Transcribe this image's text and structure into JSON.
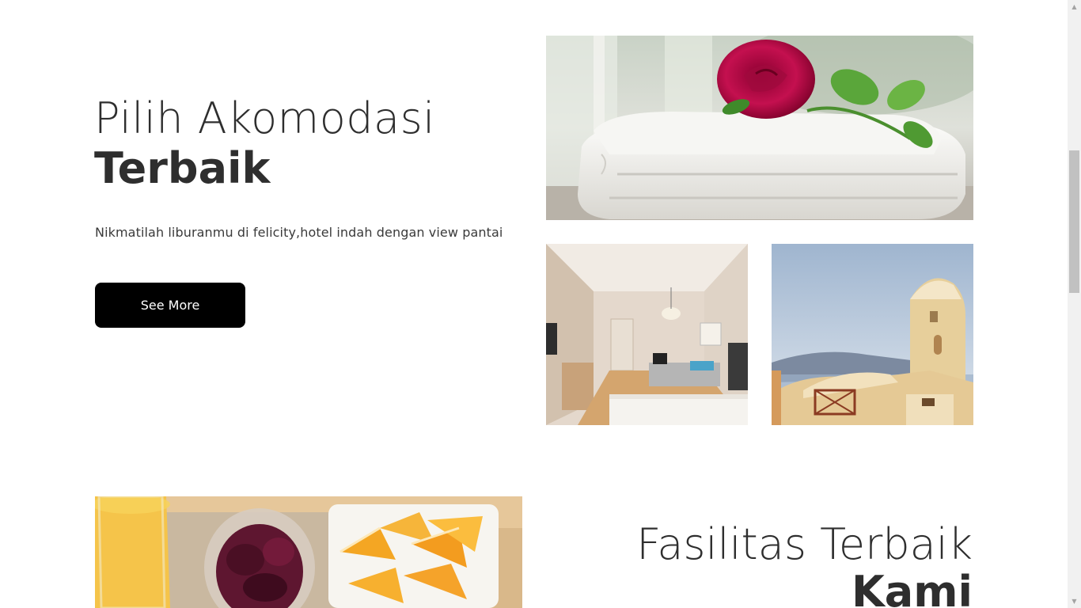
{
  "hero": {
    "title_light": "Pilih Akomodasi",
    "title_bold": "Terbaik",
    "description": "Nikmatilah liburanmu di felicity,hotel indah dengan view pantai",
    "button_label": "See More"
  },
  "facilities": {
    "title_light": "Fasilitas Terbaik",
    "title_bold": "Kami"
  },
  "images": {
    "towel": "towel-rose-photo",
    "room": "hotel-room-photo",
    "santorini": "santorini-view-photo",
    "breakfast": "breakfast-photo"
  },
  "colors": {
    "button_bg": "#000000",
    "button_text": "#ffffff",
    "heading": "#2e2e2e",
    "scrollbar_track": "#f1f1f1",
    "scrollbar_thumb": "#c1c1c1"
  }
}
